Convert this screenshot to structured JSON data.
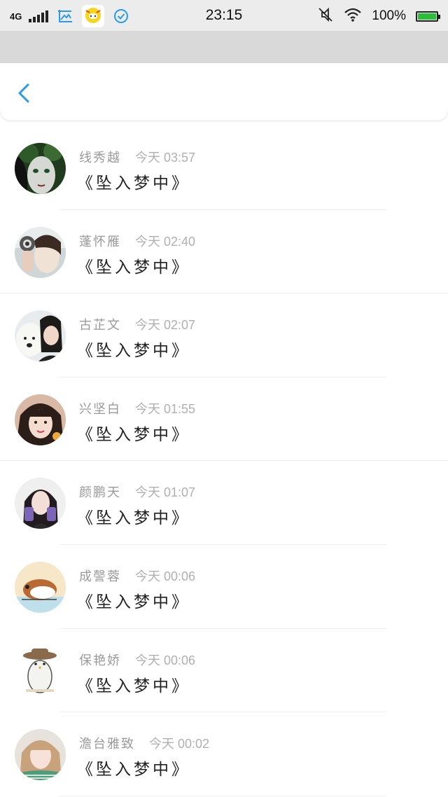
{
  "status_bar": {
    "network": "4G",
    "time": "23:15",
    "battery": "100%",
    "battery_level": 1.0,
    "icons": [
      "signal-icon",
      "gallery-icon",
      "chat-app-icon",
      "check-circle-icon",
      "mute-icon",
      "wifi-icon",
      "battery-icon"
    ]
  },
  "header": {
    "back_icon": "chevron-left-icon",
    "accent": "#2a9be8"
  },
  "items": [
    {
      "name": "线秀越",
      "time": "今天 03:57",
      "title": "《坠入梦中》"
    },
    {
      "name": "蓬怀雁",
      "time": "今天 02:40",
      "title": "《坠入梦中》"
    },
    {
      "name": "古芷文",
      "time": "今天 02:07",
      "title": "《坠入梦中》"
    },
    {
      "name": "兴坚白",
      "time": "今天 01:55",
      "title": "《坠入梦中》"
    },
    {
      "name": "颜鹏天",
      "time": "今天 01:07",
      "title": "《坠入梦中》"
    },
    {
      "name": "成謦蓉",
      "time": "今天 00:06",
      "title": "《坠入梦中》"
    },
    {
      "name": "保艳娇",
      "time": "今天 00:06",
      "title": "《坠入梦中》"
    },
    {
      "name": "澹台雅致",
      "time": "今天 00:02",
      "title": "《坠入梦中》"
    }
  ]
}
